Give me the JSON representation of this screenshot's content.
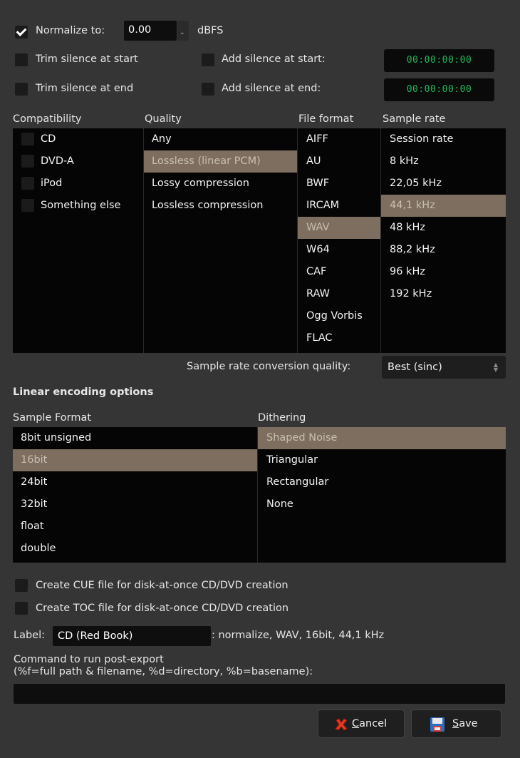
{
  "normalize": {
    "checked": true,
    "label": "Normalize to:",
    "value": "0.00",
    "unit": "dBFS"
  },
  "trim_start": {
    "checked": false,
    "label": "Trim silence at start"
  },
  "trim_end": {
    "checked": false,
    "label": "Trim silence at end"
  },
  "add_start": {
    "checked": false,
    "label": "Add silence at start:",
    "time": "00:00:00:00"
  },
  "add_end": {
    "checked": false,
    "label": "Add silence at end:",
    "time": "00:00:00:00"
  },
  "columns": {
    "compatibility": "Compatibility",
    "quality": "Quality",
    "file_format": "File format",
    "sample_rate": "Sample rate"
  },
  "compatibility_items": [
    "CD",
    "DVD-A",
    "iPod",
    "Something else"
  ],
  "quality_items": [
    "Any",
    "Lossless (linear PCM)",
    "Lossy compression",
    "Lossless compression"
  ],
  "quality_selected": 1,
  "file_formats": [
    "AIFF",
    "AU",
    "BWF",
    "IRCAM",
    "WAV",
    "W64",
    "CAF",
    "RAW",
    "Ogg Vorbis",
    "FLAC"
  ],
  "file_format_selected": 4,
  "sample_rates": [
    "Session rate",
    "8 kHz",
    "22,05 kHz",
    "44,1 kHz",
    "48 kHz",
    "88,2 kHz",
    "96 kHz",
    "192 kHz"
  ],
  "sample_rate_selected": 3,
  "src_quality": {
    "label": "Sample rate conversion quality:",
    "value": "Best (sinc)"
  },
  "linear_heading": "Linear encoding options",
  "sample_format": {
    "header": "Sample Format",
    "items": [
      "8bit unsigned",
      "16bit",
      "24bit",
      "32bit",
      "float",
      "double"
    ],
    "selected": 1
  },
  "dithering": {
    "header": "Dithering",
    "items": [
      "Shaped Noise",
      "Triangular",
      "Rectangular",
      "None"
    ],
    "selected": 0
  },
  "cue": {
    "checked": false,
    "label": "Create CUE file for disk-at-once CD/DVD creation"
  },
  "toc": {
    "checked": false,
    "label": "Create TOC file for disk-at-once CD/DVD creation"
  },
  "label_row": {
    "label": "Label:",
    "value": "CD (Red Book)",
    "summary": ": normalize, WAV, 16bit, 44,1 kHz"
  },
  "post_export": {
    "line1": "Command to run post-export",
    "line2": "(%f=full path & filename, %d=directory, %b=basename):",
    "value": ""
  },
  "buttons": {
    "cancel_mnemonic": "C",
    "cancel_rest": "ancel",
    "save_mnemonic": "S",
    "save_rest": "ave"
  },
  "colors": {
    "selection": "#7d6e5f",
    "time_text": "#1db95a",
    "background": "#353535"
  }
}
